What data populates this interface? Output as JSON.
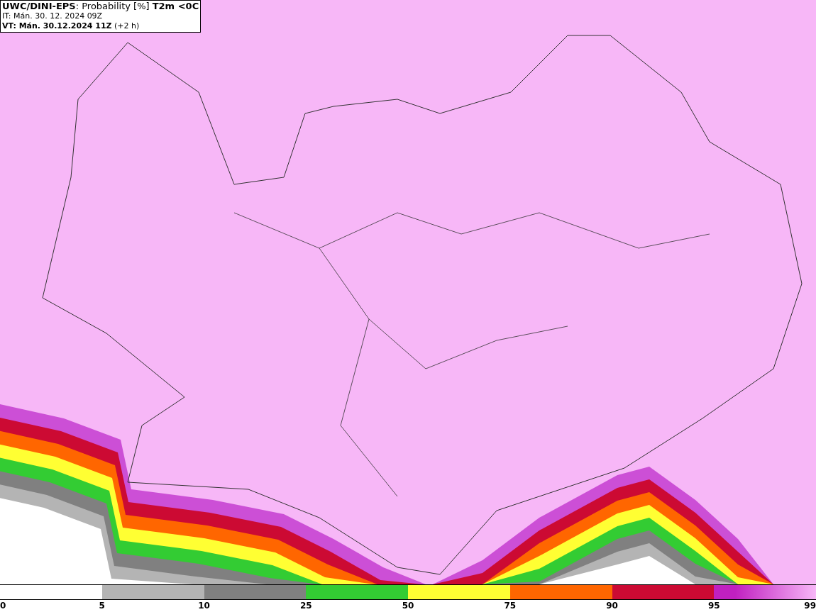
{
  "header": {
    "lines": [
      "**UWC/DINI-EPS**: Probability [%] **T2m <0C**",
      "IT: Mán. 30. 12. 2024 09Z",
      "**VT: Mán. 30.12.2024 11Z** (+2 h)"
    ]
  },
  "legend": {
    "segments": [
      {
        "kind": "blank"
      },
      {
        "color": "#b4b4b4",
        "kind": "solid"
      },
      {
        "color": "#808080",
        "kind": "solid"
      },
      {
        "color": "#33cc33",
        "kind": "solid"
      },
      {
        "color": "#ffff33",
        "kind": "solid"
      },
      {
        "color": "#ff6600",
        "kind": "solid"
      },
      {
        "color": "#cc0a33",
        "kind": "solid"
      },
      {
        "color": "#c020c0",
        "kind": "gradient"
      }
    ],
    "labels": [
      "0",
      "5",
      "10",
      "25",
      "50",
      "75",
      "90",
      "95",
      "99"
    ]
  }
}
